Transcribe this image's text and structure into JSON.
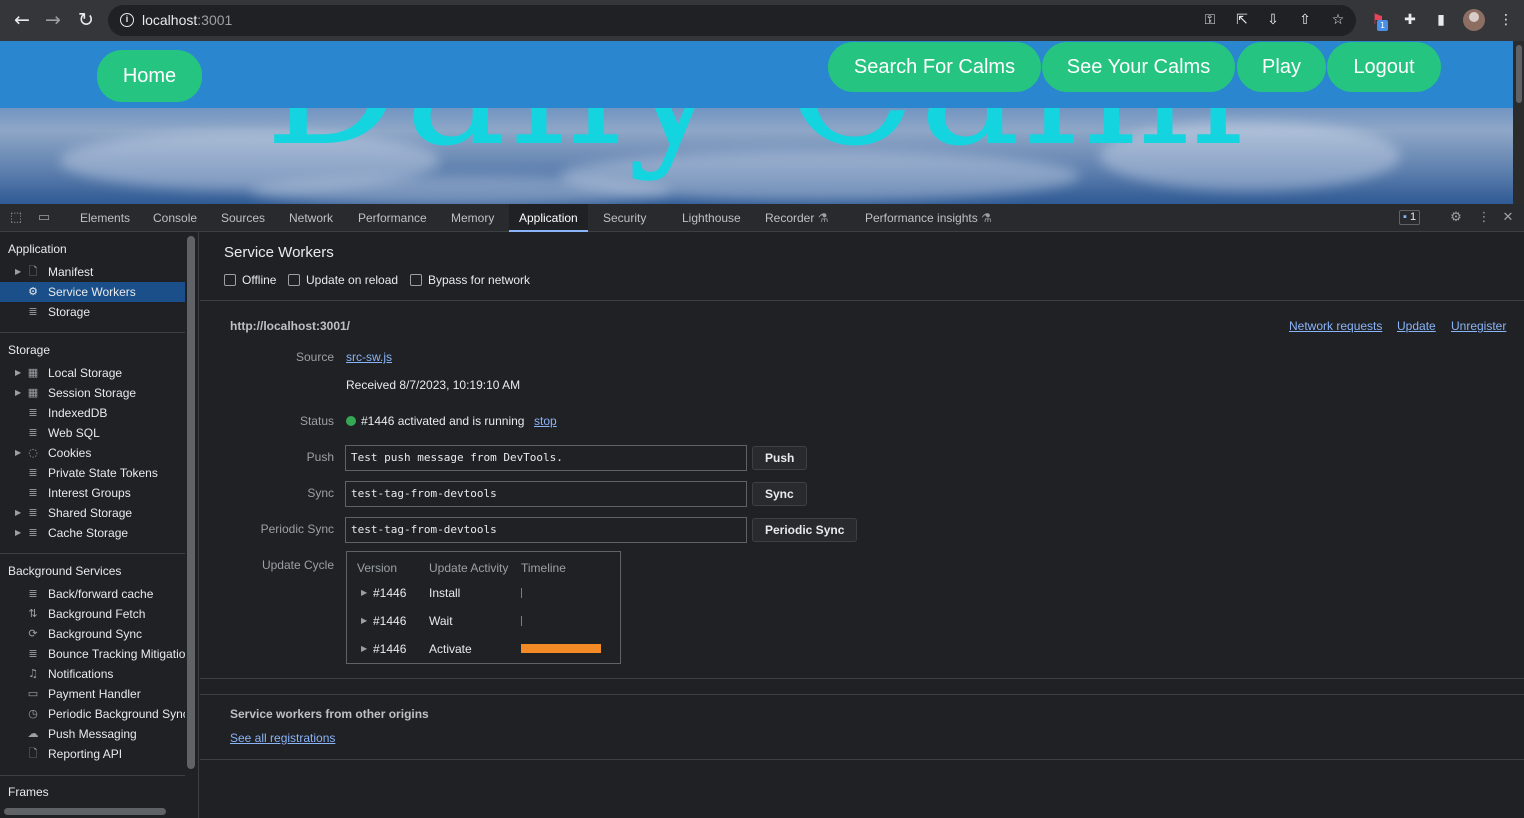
{
  "browser": {
    "url_host": "localhost",
    "url_port": ":3001",
    "extension_badge": "1"
  },
  "page": {
    "hero_title": "Daily Calm",
    "nav": {
      "home": "Home",
      "search": "Search For Calms",
      "see": "See Your Calms",
      "play": "Play",
      "logout": "Logout"
    }
  },
  "devtools": {
    "tabs": [
      "Elements",
      "Console",
      "Sources",
      "Network",
      "Performance",
      "Memory",
      "Application",
      "Security",
      "Lighthouse",
      "Recorder",
      "Performance insights"
    ],
    "active_tab": "Application",
    "issues_count": "1",
    "sidebar": {
      "application_header": "Application",
      "application_items": [
        "Manifest",
        "Service Workers",
        "Storage"
      ],
      "storage_header": "Storage",
      "storage_items": [
        "Local Storage",
        "Session Storage",
        "IndexedDB",
        "Web SQL",
        "Cookies",
        "Private State Tokens",
        "Interest Groups",
        "Shared Storage",
        "Cache Storage"
      ],
      "background_header": "Background Services",
      "background_items": [
        "Back/forward cache",
        "Background Fetch",
        "Background Sync",
        "Bounce Tracking Mitigations",
        "Notifications",
        "Payment Handler",
        "Periodic Background Sync",
        "Push Messaging",
        "Reporting API"
      ],
      "frames_header": "Frames"
    },
    "service_workers": {
      "title": "Service Workers",
      "options": [
        "Offline",
        "Update on reload",
        "Bypass for network"
      ],
      "origin": "http://localhost:3001/",
      "actions": [
        "Network requests",
        "Update",
        "Unregister"
      ],
      "source_label": "Source",
      "source_file": "src-sw.js",
      "received": "Received 8/7/2023, 10:19:10 AM",
      "status_label": "Status",
      "status_text": "#1446 activated and is running",
      "status_action": "stop",
      "push_label": "Push",
      "push_value": "Test push message from DevTools.",
      "push_button": "Push",
      "sync_label": "Sync",
      "sync_value": "test-tag-from-devtools",
      "sync_button": "Sync",
      "periodic_label": "Periodic Sync",
      "periodic_value": "test-tag-from-devtools",
      "periodic_button": "Periodic Sync",
      "cycle_label": "Update Cycle",
      "cycle_headers": [
        "Version",
        "Update Activity",
        "Timeline"
      ],
      "cycle_rows": [
        {
          "version": "#1446",
          "activity": "Install"
        },
        {
          "version": "#1446",
          "activity": "Wait"
        },
        {
          "version": "#1446",
          "activity": "Activate"
        }
      ],
      "other_origins_title": "Service workers from other origins",
      "see_all": "See all registrations"
    }
  },
  "colors": {
    "nav_bar": "#2986cf",
    "pill": "#25c481",
    "hero_text": "#14d4e0",
    "selection": "#1a4f8a",
    "status_dot": "#34a853",
    "activate_bar": "#f28b26"
  }
}
